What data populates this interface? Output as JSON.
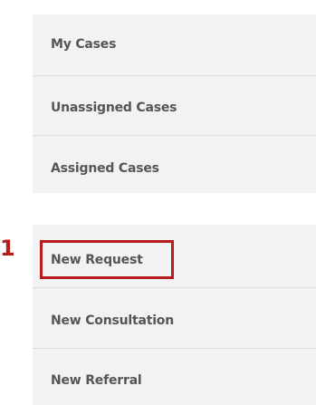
{
  "cases_menu": {
    "items": [
      {
        "label": "My Cases"
      },
      {
        "label": "Unassigned Cases"
      },
      {
        "label": "Assigned Cases"
      }
    ]
  },
  "new_menu": {
    "items": [
      {
        "label": "New Request"
      },
      {
        "label": "New Consultation"
      },
      {
        "label": "New Referral"
      }
    ]
  },
  "annotation": {
    "number": "1",
    "color": "#b71c1c"
  }
}
